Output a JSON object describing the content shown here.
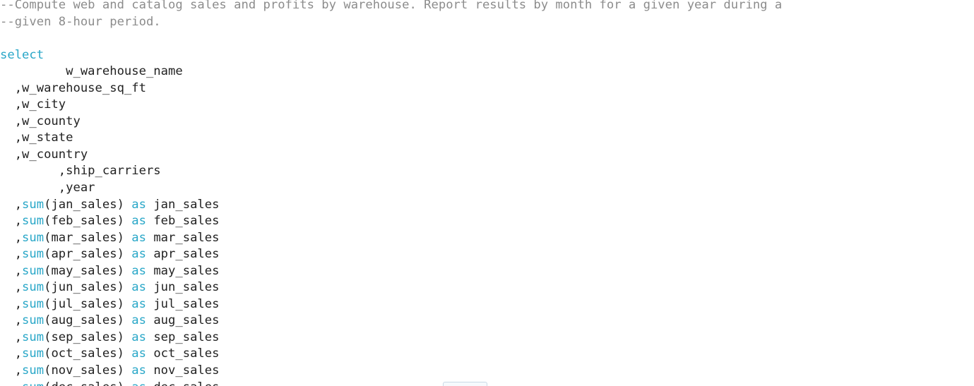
{
  "editor": {
    "lines": [
      {
        "tokens": [
          {
            "t": "--Compute web and catalog sales and profits by warehouse. Report results by month for a given year during a",
            "k": "comment"
          }
        ]
      },
      {
        "tokens": [
          {
            "t": "--given 8-hour period.",
            "k": "comment"
          }
        ]
      },
      {
        "tokens": [
          {
            "t": "",
            "k": "plain"
          }
        ]
      },
      {
        "tokens": [
          {
            "t": "select",
            "k": "kw"
          }
        ]
      },
      {
        "tokens": [
          {
            "t": "         w_warehouse_name",
            "k": "plain"
          }
        ]
      },
      {
        "tokens": [
          {
            "t": "  ,w_warehouse_sq_ft",
            "k": "plain"
          }
        ]
      },
      {
        "tokens": [
          {
            "t": "  ,w_city",
            "k": "plain"
          }
        ]
      },
      {
        "tokens": [
          {
            "t": "  ,w_county",
            "k": "plain"
          }
        ]
      },
      {
        "tokens": [
          {
            "t": "  ,w_state",
            "k": "plain"
          }
        ]
      },
      {
        "tokens": [
          {
            "t": "  ,w_country",
            "k": "plain"
          }
        ]
      },
      {
        "tokens": [
          {
            "t": "        ,ship_carriers",
            "k": "plain"
          }
        ]
      },
      {
        "tokens": [
          {
            "t": "        ,year",
            "k": "plain"
          }
        ]
      },
      {
        "tokens": [
          {
            "t": "  ,",
            "k": "plain"
          },
          {
            "t": "sum",
            "k": "kw"
          },
          {
            "t": "(jan_sales) ",
            "k": "plain"
          },
          {
            "t": "as",
            "k": "kw"
          },
          {
            "t": " jan_sales",
            "k": "plain"
          }
        ]
      },
      {
        "tokens": [
          {
            "t": "  ,",
            "k": "plain"
          },
          {
            "t": "sum",
            "k": "kw"
          },
          {
            "t": "(feb_sales) ",
            "k": "plain"
          },
          {
            "t": "as",
            "k": "kw"
          },
          {
            "t": " feb_sales",
            "k": "plain"
          }
        ]
      },
      {
        "tokens": [
          {
            "t": "  ,",
            "k": "plain"
          },
          {
            "t": "sum",
            "k": "kw"
          },
          {
            "t": "(mar_sales) ",
            "k": "plain"
          },
          {
            "t": "as",
            "k": "kw"
          },
          {
            "t": " mar_sales",
            "k": "plain"
          }
        ]
      },
      {
        "tokens": [
          {
            "t": "  ,",
            "k": "plain"
          },
          {
            "t": "sum",
            "k": "kw"
          },
          {
            "t": "(apr_sales) ",
            "k": "plain"
          },
          {
            "t": "as",
            "k": "kw"
          },
          {
            "t": " apr_sales",
            "k": "plain"
          }
        ]
      },
      {
        "tokens": [
          {
            "t": "  ,",
            "k": "plain"
          },
          {
            "t": "sum",
            "k": "kw"
          },
          {
            "t": "(may_sales) ",
            "k": "plain"
          },
          {
            "t": "as",
            "k": "kw"
          },
          {
            "t": " may_sales",
            "k": "plain"
          }
        ]
      },
      {
        "tokens": [
          {
            "t": "  ,",
            "k": "plain"
          },
          {
            "t": "sum",
            "k": "kw"
          },
          {
            "t": "(jun_sales) ",
            "k": "plain"
          },
          {
            "t": "as",
            "k": "kw"
          },
          {
            "t": " jun_sales",
            "k": "plain"
          }
        ]
      },
      {
        "tokens": [
          {
            "t": "  ,",
            "k": "plain"
          },
          {
            "t": "sum",
            "k": "kw"
          },
          {
            "t": "(jul_sales) ",
            "k": "plain"
          },
          {
            "t": "as",
            "k": "kw"
          },
          {
            "t": " jul_sales",
            "k": "plain"
          }
        ]
      },
      {
        "tokens": [
          {
            "t": "  ,",
            "k": "plain"
          },
          {
            "t": "sum",
            "k": "kw"
          },
          {
            "t": "(aug_sales) ",
            "k": "plain"
          },
          {
            "t": "as",
            "k": "kw"
          },
          {
            "t": " aug_sales",
            "k": "plain"
          }
        ]
      },
      {
        "tokens": [
          {
            "t": "  ,",
            "k": "plain"
          },
          {
            "t": "sum",
            "k": "kw"
          },
          {
            "t": "(sep_sales) ",
            "k": "plain"
          },
          {
            "t": "as",
            "k": "kw"
          },
          {
            "t": " sep_sales",
            "k": "plain"
          }
        ]
      },
      {
        "tokens": [
          {
            "t": "  ,",
            "k": "plain"
          },
          {
            "t": "sum",
            "k": "kw"
          },
          {
            "t": "(oct_sales) ",
            "k": "plain"
          },
          {
            "t": "as",
            "k": "kw"
          },
          {
            "t": " oct_sales",
            "k": "plain"
          }
        ]
      },
      {
        "tokens": [
          {
            "t": "  ,",
            "k": "plain"
          },
          {
            "t": "sum",
            "k": "kw"
          },
          {
            "t": "(nov_sales) ",
            "k": "plain"
          },
          {
            "t": "as",
            "k": "kw"
          },
          {
            "t": " nov_sales",
            "k": "plain"
          }
        ]
      },
      {
        "tokens": [
          {
            "t": "  ,",
            "k": "plain"
          },
          {
            "t": "sum",
            "k": "kw"
          },
          {
            "t": "(dec_sales) ",
            "k": "plain"
          },
          {
            "t": "as",
            "k": "kw"
          },
          {
            "t": " dec_sales",
            "k": "plain"
          }
        ]
      }
    ]
  },
  "colors": {
    "background": "#ffffff",
    "comment": "#8c8c8c",
    "keyword": "#29a7c8",
    "text": "#222222"
  }
}
